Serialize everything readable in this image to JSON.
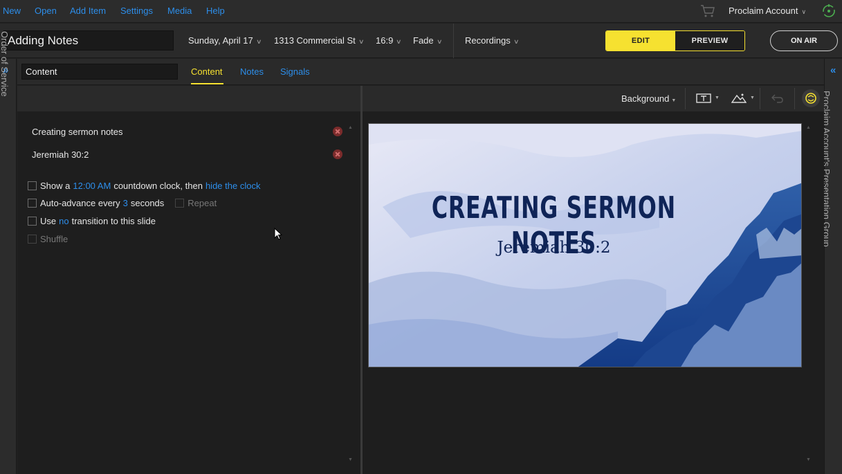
{
  "menu": {
    "items": [
      "New",
      "Open",
      "Add Item",
      "Settings",
      "Media",
      "Help"
    ],
    "account": "Proclaim Account"
  },
  "toolbar": {
    "title": "Adding Notes",
    "date": "Sunday, April 17",
    "location": "1313 Commercial St",
    "aspect": "16:9",
    "transition": "Fade",
    "recordings": "Recordings",
    "edit_label": "EDIT",
    "preview_label": "PREVIEW",
    "onair_label": "ON AIR"
  },
  "sidebar": {
    "left_label": "Order of Service",
    "right_label": "Proclaim Account's Presentation Group"
  },
  "content": {
    "name_value": "Content",
    "tabs": [
      "Content",
      "Notes",
      "Signals"
    ],
    "active_tab": "Content"
  },
  "fields": [
    {
      "text": "Creating sermon notes"
    },
    {
      "text": "Jeremiah 30:2"
    }
  ],
  "options": {
    "countdown": {
      "prefix": "Show a",
      "time": "12:00 AM",
      "middle": "countdown clock, then",
      "action": "hide the clock"
    },
    "autoadvance": {
      "prefix": "Auto-advance every",
      "value": "3",
      "suffix": "seconds",
      "repeat": "Repeat"
    },
    "transition": {
      "prefix": "Use",
      "value": "no",
      "suffix": "transition to this slide"
    },
    "shuffle": "Shuffle"
  },
  "preview": {
    "background_label": "Background",
    "slide_title": "CREATING SERMON NOTES",
    "slide_subtitle": "Jeremiah 30:2"
  },
  "colors": {
    "accent": "#2d8eea",
    "active_yellow": "#f6e130",
    "slide_text": "#0f2457"
  }
}
